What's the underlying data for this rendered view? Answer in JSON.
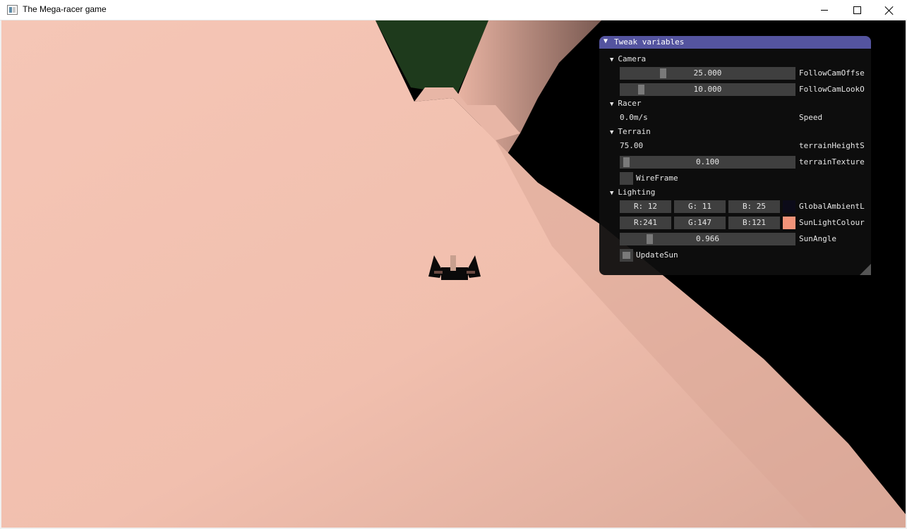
{
  "window": {
    "title": "The Mega-racer game"
  },
  "scene": {
    "terrain_color": "#f3c2b1",
    "sky_color": "#000000",
    "trees_color": "#1e3a1c",
    "racer_icon": "racer-car-sprite"
  },
  "panel": {
    "title": "Tweak variables",
    "camera": {
      "label": "Camera",
      "follow_offset": {
        "value": "25.000",
        "label": "FollowCamOffse",
        "fraction": 0.25
      },
      "follow_lookat": {
        "value": "10.000",
        "label": "FollowCamLookO",
        "fraction": 0.1
      }
    },
    "racer": {
      "label": "Racer",
      "speed": {
        "value": "0.0m/s",
        "label": "Speed"
      }
    },
    "terrain": {
      "label": "Terrain",
      "height_scale": {
        "value": "75.00",
        "label": "terrainHeightS"
      },
      "texture": {
        "value": "0.100",
        "label": "terrainTexture",
        "fraction": 0.02
      },
      "wireframe": {
        "label": "WireFrame",
        "checked": false
      }
    },
    "lighting": {
      "label": "Lighting",
      "ambient": {
        "r": "R: 12",
        "g": "G: 11",
        "b": "B: 25",
        "label": "GlobalAmbientL",
        "color": "#0c0b19"
      },
      "sun": {
        "r": "R:241",
        "g": "G:147",
        "b": "B:121",
        "label": "SunLightColour",
        "color": "#f19379"
      },
      "sun_angle": {
        "value": "0.966",
        "label": "SunAngle",
        "fraction": 0.15
      },
      "update_sun": {
        "label": "UpdateSun",
        "checked": true
      }
    }
  }
}
